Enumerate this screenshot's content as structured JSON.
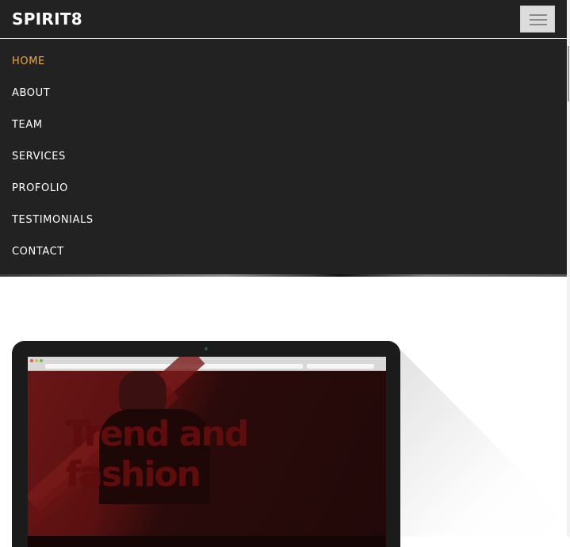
{
  "brand": {
    "name": "SPIRIT8"
  },
  "menu": {
    "items": [
      {
        "label": "HOME",
        "active": true
      },
      {
        "label": "ABOUT",
        "active": false
      },
      {
        "label": "TEAM",
        "active": false
      },
      {
        "label": "SERVICES",
        "active": false
      },
      {
        "label": "PROFOLIO",
        "active": false
      },
      {
        "label": "TESTIMONIALS",
        "active": false
      },
      {
        "label": "CONTACT",
        "active": false
      }
    ]
  },
  "mockup": {
    "screen_title": "Trend and fashion"
  },
  "colors": {
    "navbar_bg": "#222222",
    "accent_active": "#f0a93b",
    "menu_text": "#ffffff"
  },
  "icons": {
    "toggle": "hamburger-menu-icon"
  }
}
